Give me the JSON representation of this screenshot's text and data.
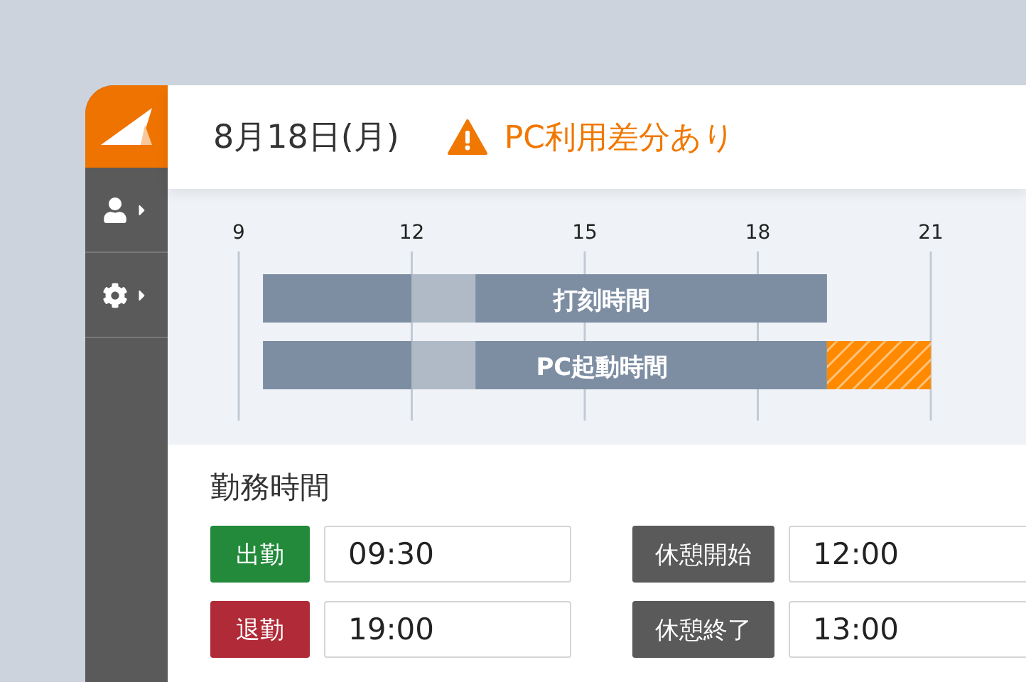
{
  "sidebar": {
    "items": [
      {
        "kind": "logo"
      },
      {
        "kind": "user"
      },
      {
        "kind": "settings"
      }
    ]
  },
  "header": {
    "date": "8月18日(月)",
    "warning": "PC利用差分あり"
  },
  "timeline": {
    "ticks": [
      "9",
      "12",
      "15",
      "18",
      "21"
    ],
    "bars": [
      {
        "label": "打刻時間",
        "difference": false
      },
      {
        "label": "PC起動時間",
        "difference": true
      }
    ]
  },
  "work": {
    "title": "勤務時間",
    "entries": [
      {
        "label": "出勤",
        "color": "#228a3a",
        "value": "09:30"
      },
      {
        "label": "休憩開始",
        "color": "#5a5a5a",
        "value": "12:00"
      },
      {
        "label": "退勤",
        "color": "#b12a37",
        "value": "19:00"
      },
      {
        "label": "休憩終了",
        "color": "#5a5a5a",
        "value": "13:00"
      }
    ]
  }
}
